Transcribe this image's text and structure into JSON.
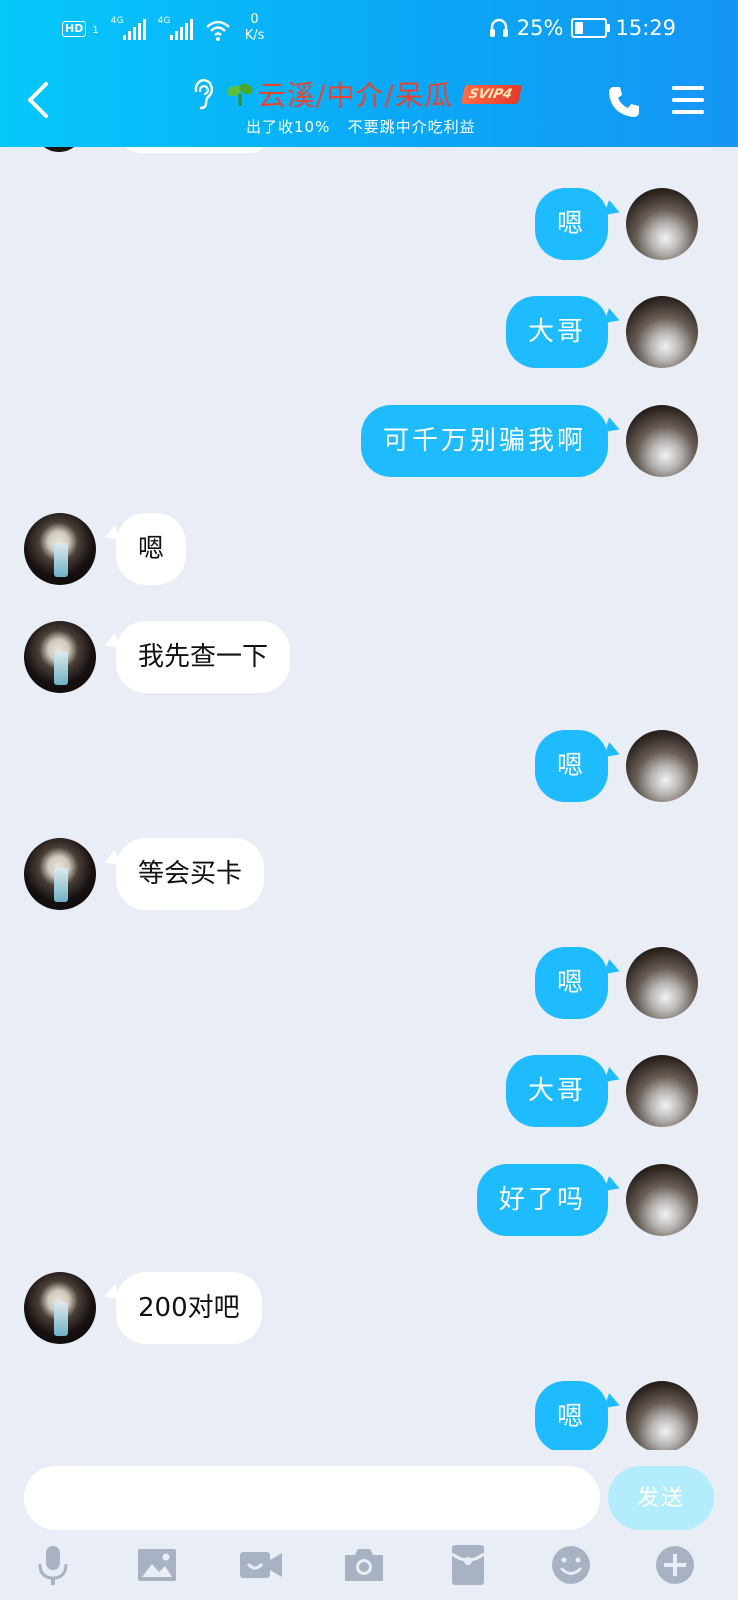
{
  "status_bar": {
    "hd_label": "HD",
    "sim_number": "1",
    "network1": "4G",
    "network2": "4G",
    "speed_value": "0",
    "speed_unit": "K/s",
    "battery_percent": "25%",
    "time": "15:29"
  },
  "header": {
    "title": "云溪/中介/呆瓜",
    "badge": "SVIP4",
    "subtitle": "出了收10%   不要跳中介吃利益"
  },
  "messages": [
    {
      "side": "right",
      "text": "嗯"
    },
    {
      "side": "right",
      "text": "大哥"
    },
    {
      "side": "right",
      "text": "可千万别骗我啊"
    },
    {
      "side": "left",
      "text": "嗯"
    },
    {
      "side": "left",
      "text": "我先查一下"
    },
    {
      "side": "right",
      "text": "嗯"
    },
    {
      "side": "left",
      "text": "等会买卡"
    },
    {
      "side": "right",
      "text": "嗯"
    },
    {
      "side": "right",
      "text": "大哥"
    },
    {
      "side": "right",
      "text": "好了吗"
    },
    {
      "side": "left",
      "text": "200对吧"
    },
    {
      "side": "right",
      "text": "嗯"
    }
  ],
  "input": {
    "value": "",
    "placeholder": "",
    "send_label": "发送"
  },
  "toolbar_icons": [
    "microphone-icon",
    "image-icon",
    "video-icon",
    "camera-icon",
    "red-packet-icon",
    "emoji-icon",
    "plus-icon"
  ],
  "colors": {
    "header_gradient_start": "#06c8fb",
    "header_gradient_end": "#1596f3",
    "outgoing_bubble": "#1ebcff",
    "incoming_bubble": "#ffffff",
    "chat_background": "#e9edf5",
    "title_color": "#e8442f",
    "send_button": "#b3ecfb"
  }
}
